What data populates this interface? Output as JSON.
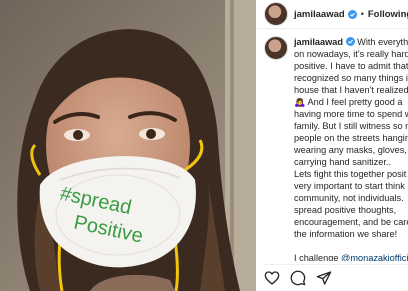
{
  "post": {
    "username": "jamilaawad",
    "separator": "•",
    "follow_label": "Following",
    "mask_text_line1": "#spread",
    "mask_text_line2": "Positive"
  },
  "caption": {
    "username": "jamilaawad",
    "lines": [
      "With everythi",
      "on nowadays, it's really hard",
      "positive. I have to admit that",
      "recognized so many things i",
      "house that I haven't realized",
      "🙇‍♀️ And I feel pretty good a",
      "having more time to spend w",
      "family. But I still witness so m",
      "people on the streets hangin",
      "wearing any masks, gloves, o",
      "carrying hand sanitizer..",
      "Lets fight this together posit",
      "very important to start think",
      "community, not individuals.",
      "spread positive thoughts,",
      "encouragement, and be care",
      "the information we share!",
      "",
      "I challenge"
    ],
    "mention": "@monazakiofficia"
  },
  "icons": {
    "verified": "verified-badge-icon",
    "like": "heart-icon",
    "comment": "comment-icon",
    "share": "paper-plane-icon"
  },
  "colors": {
    "verified_blue": "#3897f0",
    "mask_strap": "#f2c40c",
    "mask_writing": "#3a9c45"
  }
}
